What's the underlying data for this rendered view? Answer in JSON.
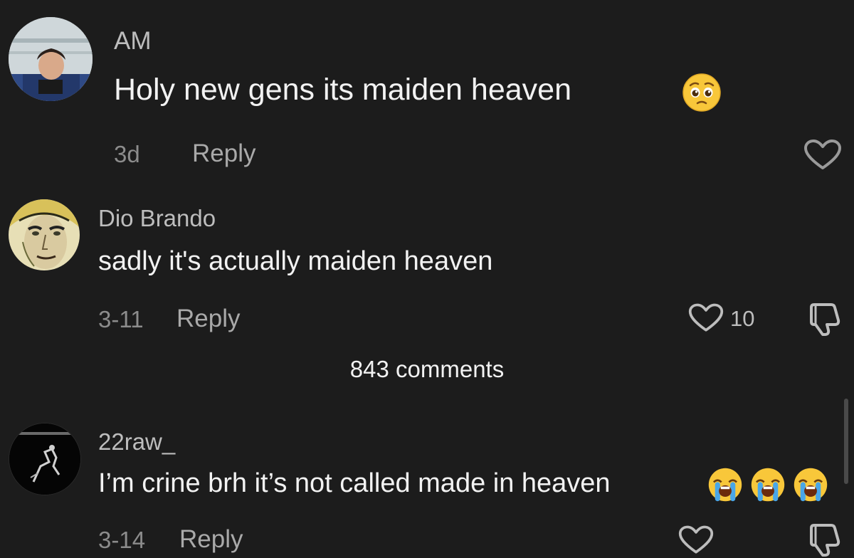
{
  "comments": [
    {
      "username": "AM",
      "text": "Holy new gens its maiden heaven",
      "emoji": "pleading-face-icon",
      "date": "3d",
      "reply_label": "Reply"
    },
    {
      "username": "Dio Brando",
      "text": "sadly it's actually maiden heaven",
      "date": "3-11",
      "reply_label": "Reply",
      "like_count": "10"
    },
    {
      "username": "22raw_",
      "text": "I’m crine brh it’s not called made in heaven",
      "emojis": [
        "loudly-crying-face-icon",
        "loudly-crying-face-icon",
        "loudly-crying-face-icon"
      ],
      "date": "3-14",
      "reply_label": "Reply"
    }
  ],
  "thread_footer": {
    "comments_count_label": "843 comments"
  }
}
